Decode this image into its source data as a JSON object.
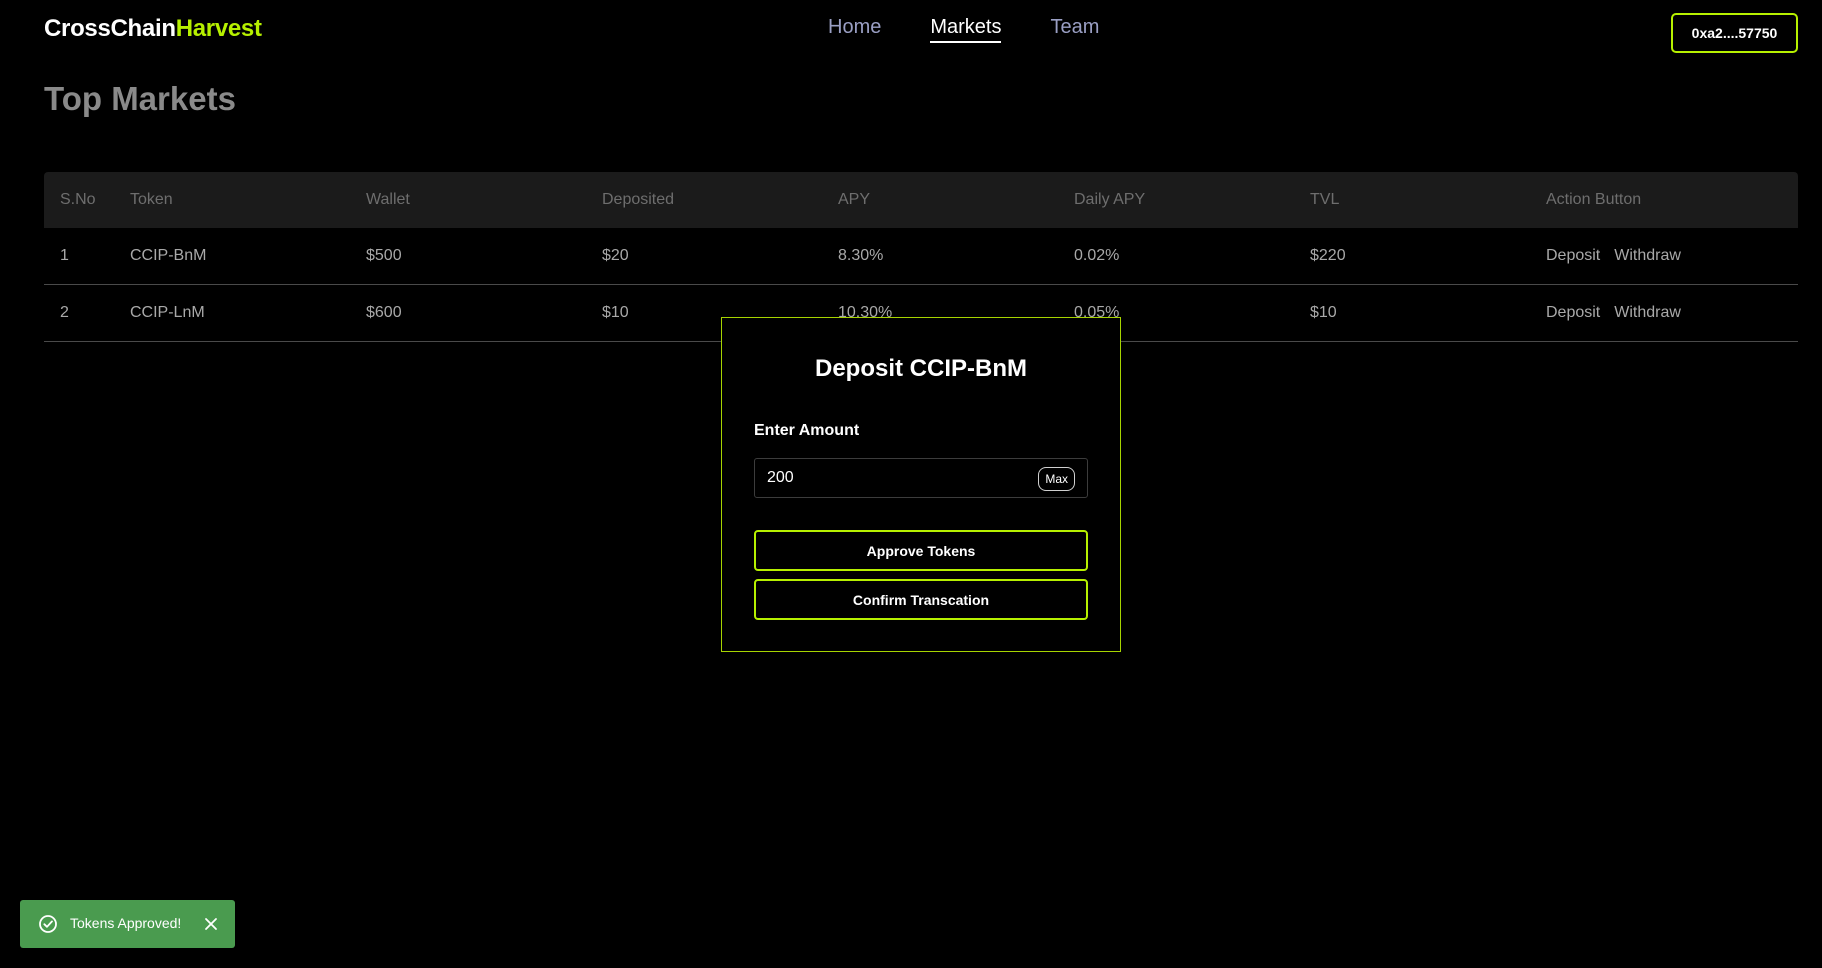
{
  "brand": {
    "part1": "CrossChain",
    "part2": "Harvest"
  },
  "nav": {
    "items": [
      "Home",
      "Markets",
      "Team"
    ],
    "active": "Markets"
  },
  "wallet": {
    "address": "0xa2....57750"
  },
  "page": {
    "title": "Top Markets"
  },
  "table": {
    "headers": [
      "S.No",
      "Token",
      "Wallet",
      "Deposited",
      "APY",
      "Daily APY",
      "TVL",
      "Action Button"
    ],
    "rows": [
      {
        "sno": "1",
        "token": "CCIP-BnM",
        "wallet": "$500",
        "deposited": "$20",
        "apy": "8.30%",
        "daily_apy": "0.02%",
        "tvl": "$220",
        "deposit": "Deposit",
        "withdraw": "Withdraw"
      },
      {
        "sno": "2",
        "token": "CCIP-LnM",
        "wallet": "$600",
        "deposited": "$10",
        "apy": "10.30%",
        "daily_apy": "0.05%",
        "tvl": "$10",
        "deposit": "Deposit",
        "withdraw": "Withdraw"
      }
    ]
  },
  "modal": {
    "title": "Deposit CCIP-BnM",
    "amount_label": "Enter Amount",
    "amount_value": "200",
    "max_label": "Max",
    "approve_label": "Approve Tokens",
    "confirm_label": "Confirm Transcation"
  },
  "toast": {
    "message": "Tokens Approved!",
    "icon": "check-circle-icon",
    "close_icon": "close-icon"
  },
  "colors": {
    "accent": "#b6f000",
    "toast": "#4a9b4f",
    "background": "#000000"
  }
}
